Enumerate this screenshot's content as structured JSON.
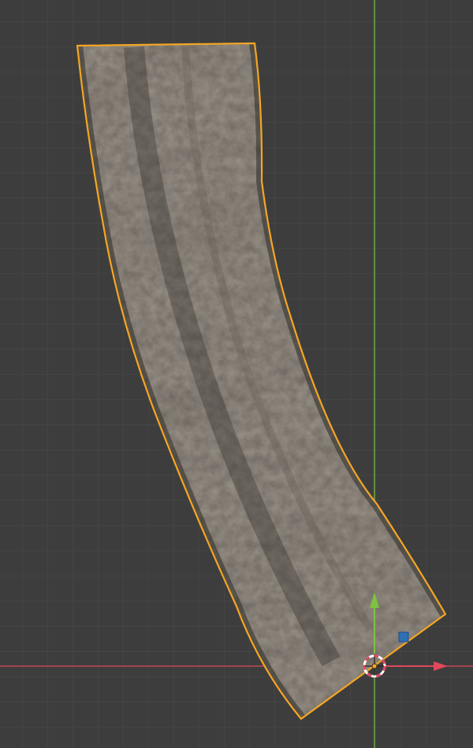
{
  "viewport": {
    "view": "top-orthographic",
    "background_color": "#3d3d3d",
    "grid_minor_color": "#4a4a4a",
    "grid_major_color": "#535353"
  },
  "axes": {
    "x_axis_color": "#d9485f",
    "y_axis_color": "#7fc241"
  },
  "selected_object": {
    "type": "curved-road-plane",
    "material": "dark-asphalt-dirt-texture",
    "outline_color": "#f5a623",
    "surface_color": "#4a4540"
  },
  "gizmo": {
    "translate_x_arrow_color": "#e0485c",
    "translate_y_arrow_color": "#7fc241",
    "xy_plane_handle_color": "#2f6fb5",
    "origin_ring_color": "#ffffff"
  }
}
